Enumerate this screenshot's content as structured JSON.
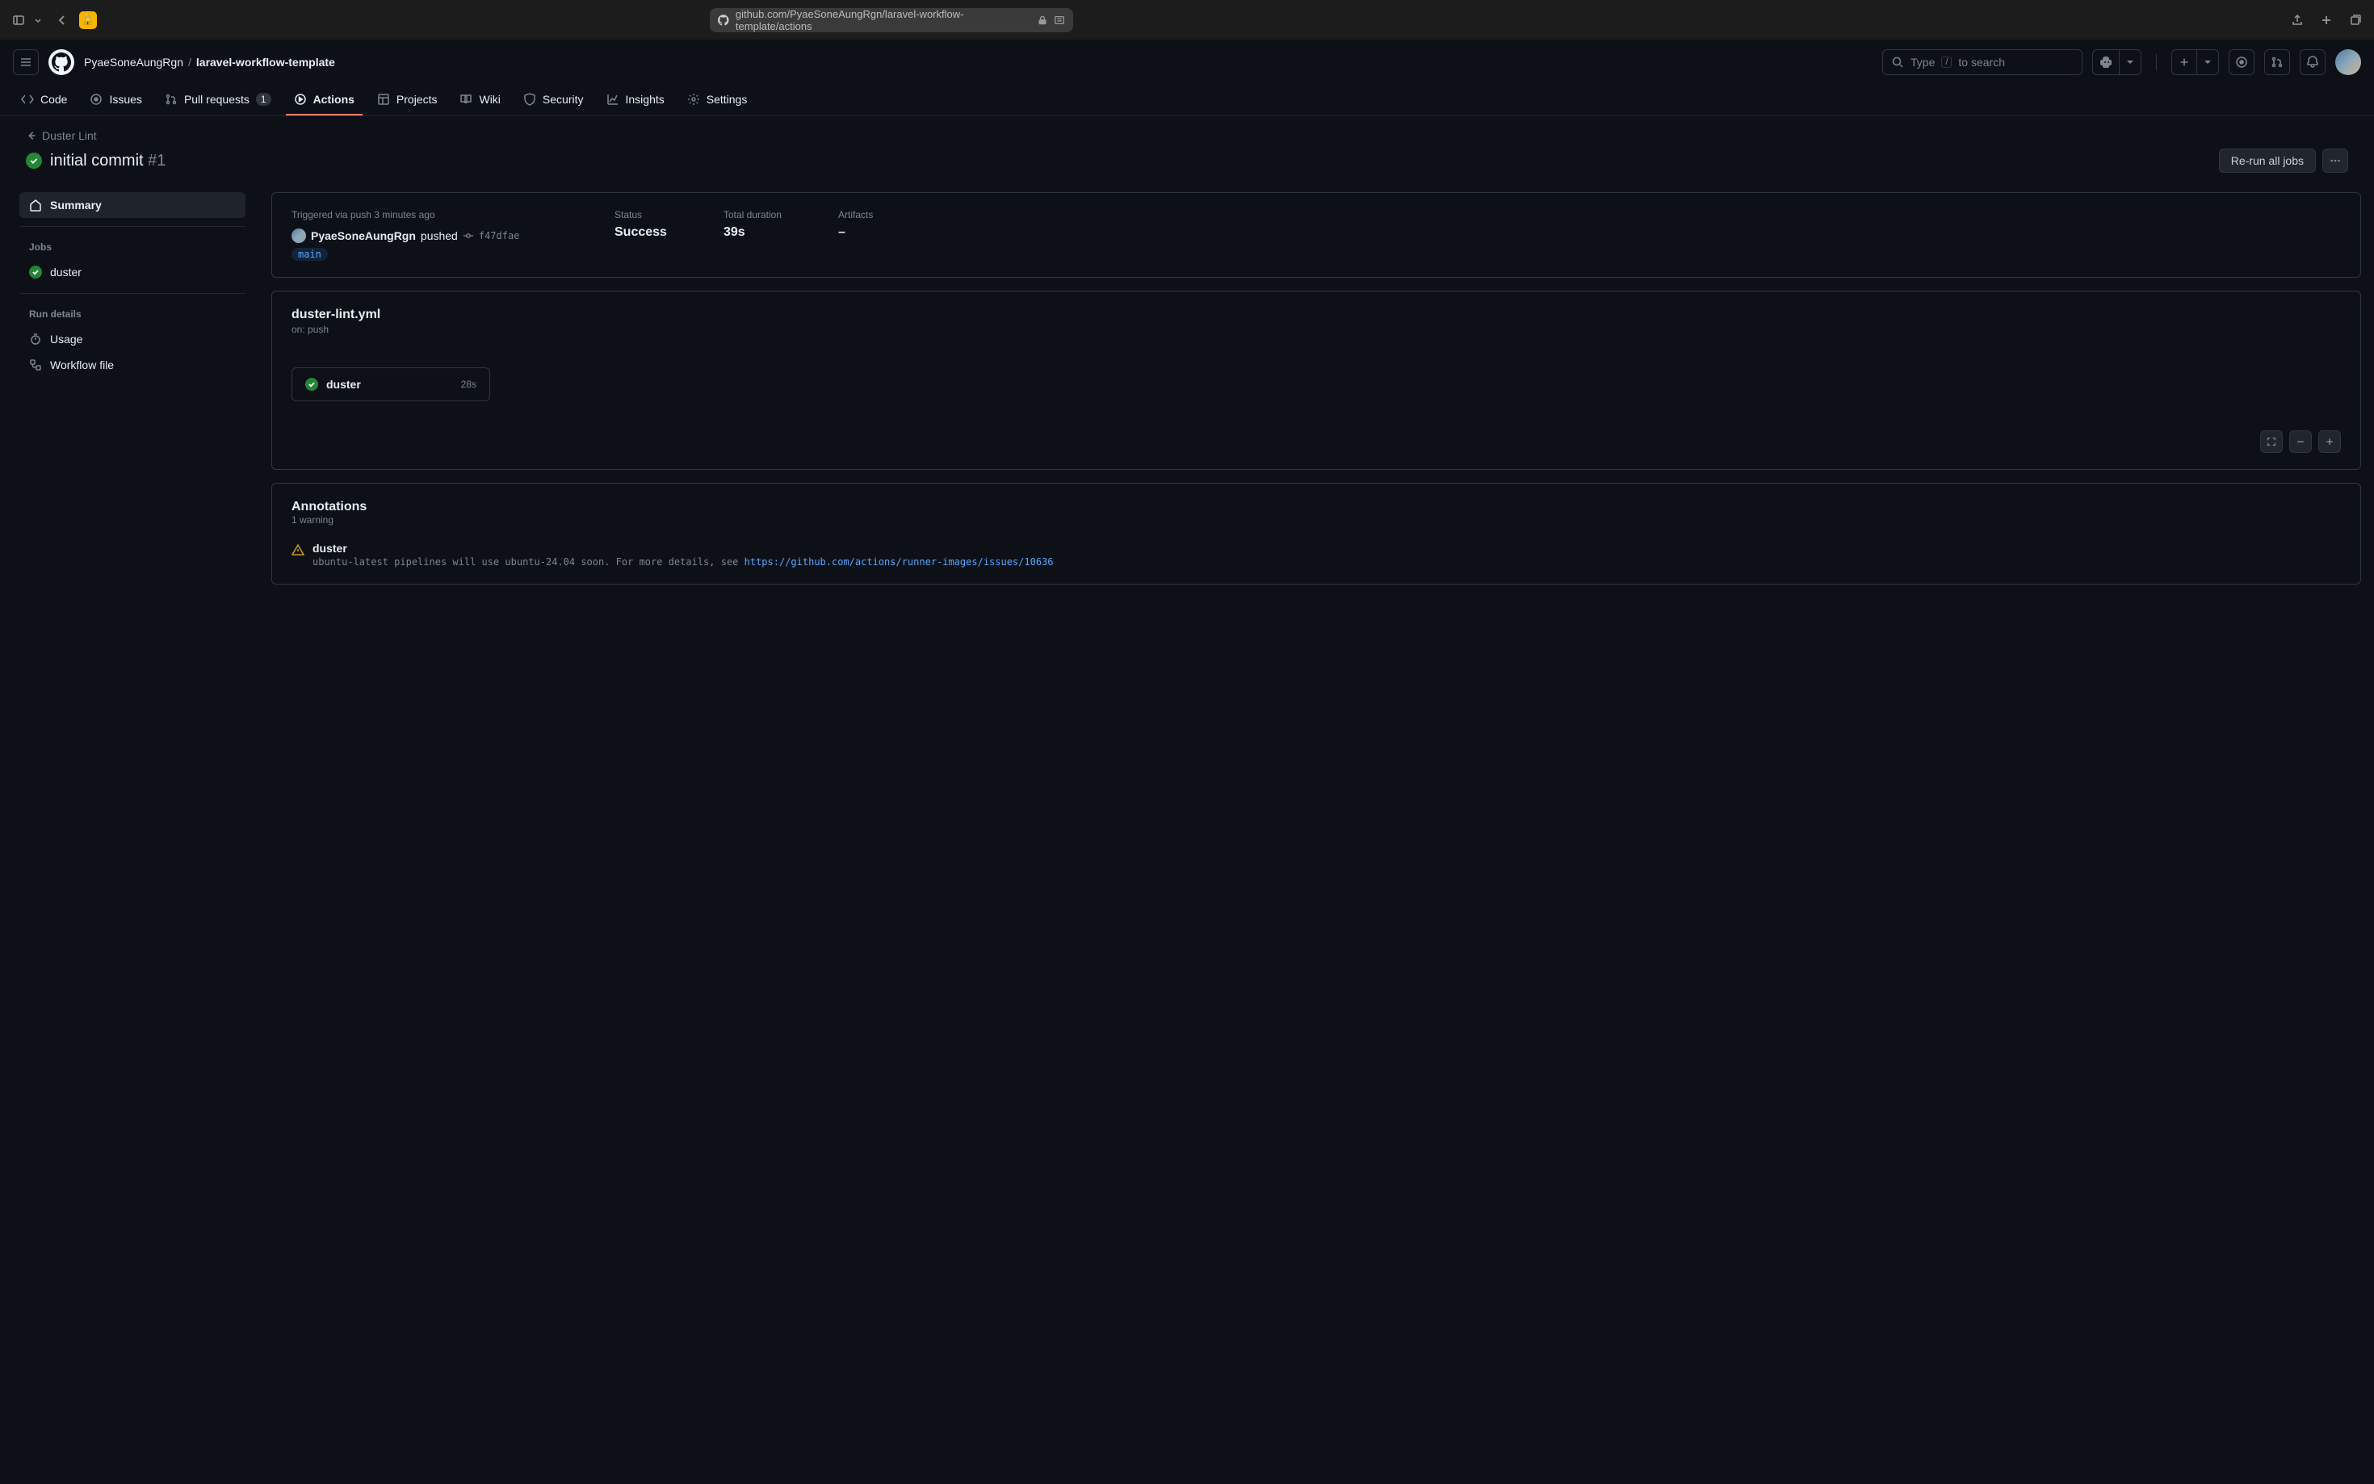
{
  "chrome": {
    "url": "github.com/PyaeSoneAungRgn/laravel-workflow-template/actions"
  },
  "header": {
    "owner": "PyaeSoneAungRgn",
    "repo": "laravel-workflow-template",
    "search_prefix": "Type",
    "search_slash": "/",
    "search_suffix": "to search"
  },
  "nav": {
    "code": "Code",
    "issues": "Issues",
    "pulls": "Pull requests",
    "pulls_count": "1",
    "actions": "Actions",
    "projects": "Projects",
    "wiki": "Wiki",
    "security": "Security",
    "insights": "Insights",
    "settings": "Settings"
  },
  "page": {
    "back_link": "Duster Lint",
    "title": "initial commit",
    "run_number": "#1",
    "rerun_label": "Re-run all jobs"
  },
  "sidebar": {
    "summary": "Summary",
    "jobs_heading": "Jobs",
    "job_duster": "duster",
    "run_details_heading": "Run details",
    "usage": "Usage",
    "workflow_file": "Workflow file"
  },
  "summary": {
    "trigger_text": "Triggered via push 3 minutes ago",
    "actor": "PyaeSoneAungRgn",
    "action": "pushed",
    "commit": "f47dfae",
    "branch": "main",
    "status_label": "Status",
    "status_value": "Success",
    "duration_label": "Total duration",
    "duration_value": "39s",
    "artifacts_label": "Artifacts",
    "artifacts_value": "–"
  },
  "workflow": {
    "name": "duster-lint.yml",
    "trigger": "on: push",
    "job_name": "duster",
    "job_time": "28s"
  },
  "annotations": {
    "title": "Annotations",
    "count_text": "1 warning",
    "source": "duster",
    "message": "ubuntu-latest pipelines will use ubuntu-24.04 soon. For more details, see ",
    "link": "https://github.com/actions/runner-images/issues/10636"
  }
}
